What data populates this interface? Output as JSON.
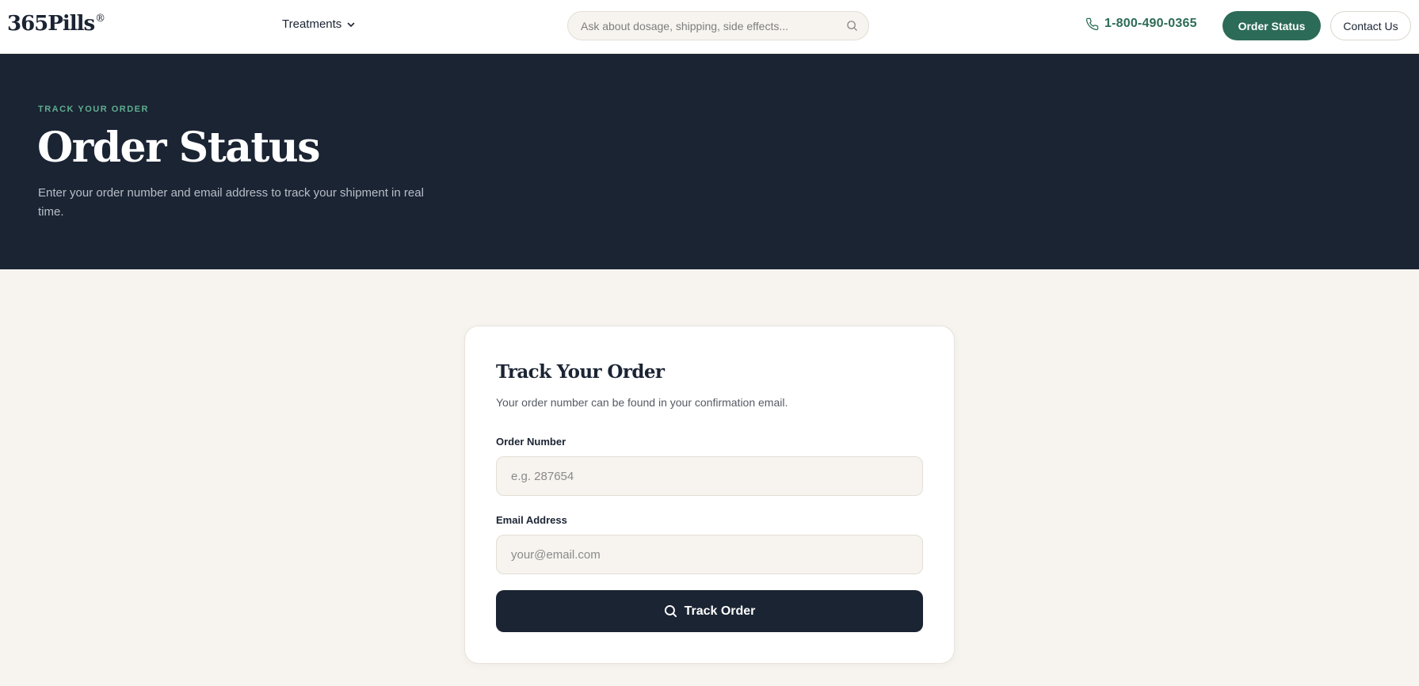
{
  "header": {
    "logo_text": "365Pills",
    "logo_mark": "®",
    "nav_treatments": "Treatments",
    "search_placeholder": "Ask about dosage, shipping, side effects...",
    "phone": "1-800-490-0365",
    "order_status_button": "Order Status",
    "contact_button": "Contact Us"
  },
  "hero": {
    "eyebrow": "TRACK YOUR ORDER",
    "title": "Order Status",
    "subtitle": "Enter your order number and email address to track your shipment in real time."
  },
  "form": {
    "title": "Track Your Order",
    "subtitle": "Your order number can be found in your confirmation email.",
    "order_number_label": "Order Number",
    "order_number_placeholder": "e.g. 287654",
    "order_number_value": "",
    "email_label": "Email Address",
    "email_placeholder": "your@email.com",
    "email_value": "",
    "submit_label": "Track Order"
  },
  "icons": {
    "chevron": "chevron-down-icon",
    "search": "search-icon",
    "phone": "phone-icon"
  },
  "colors": {
    "brand_green": "#2c6b57",
    "navy": "#1b2433",
    "eyebrow_green": "#5fae90",
    "page_bg": "#f7f4ef"
  }
}
